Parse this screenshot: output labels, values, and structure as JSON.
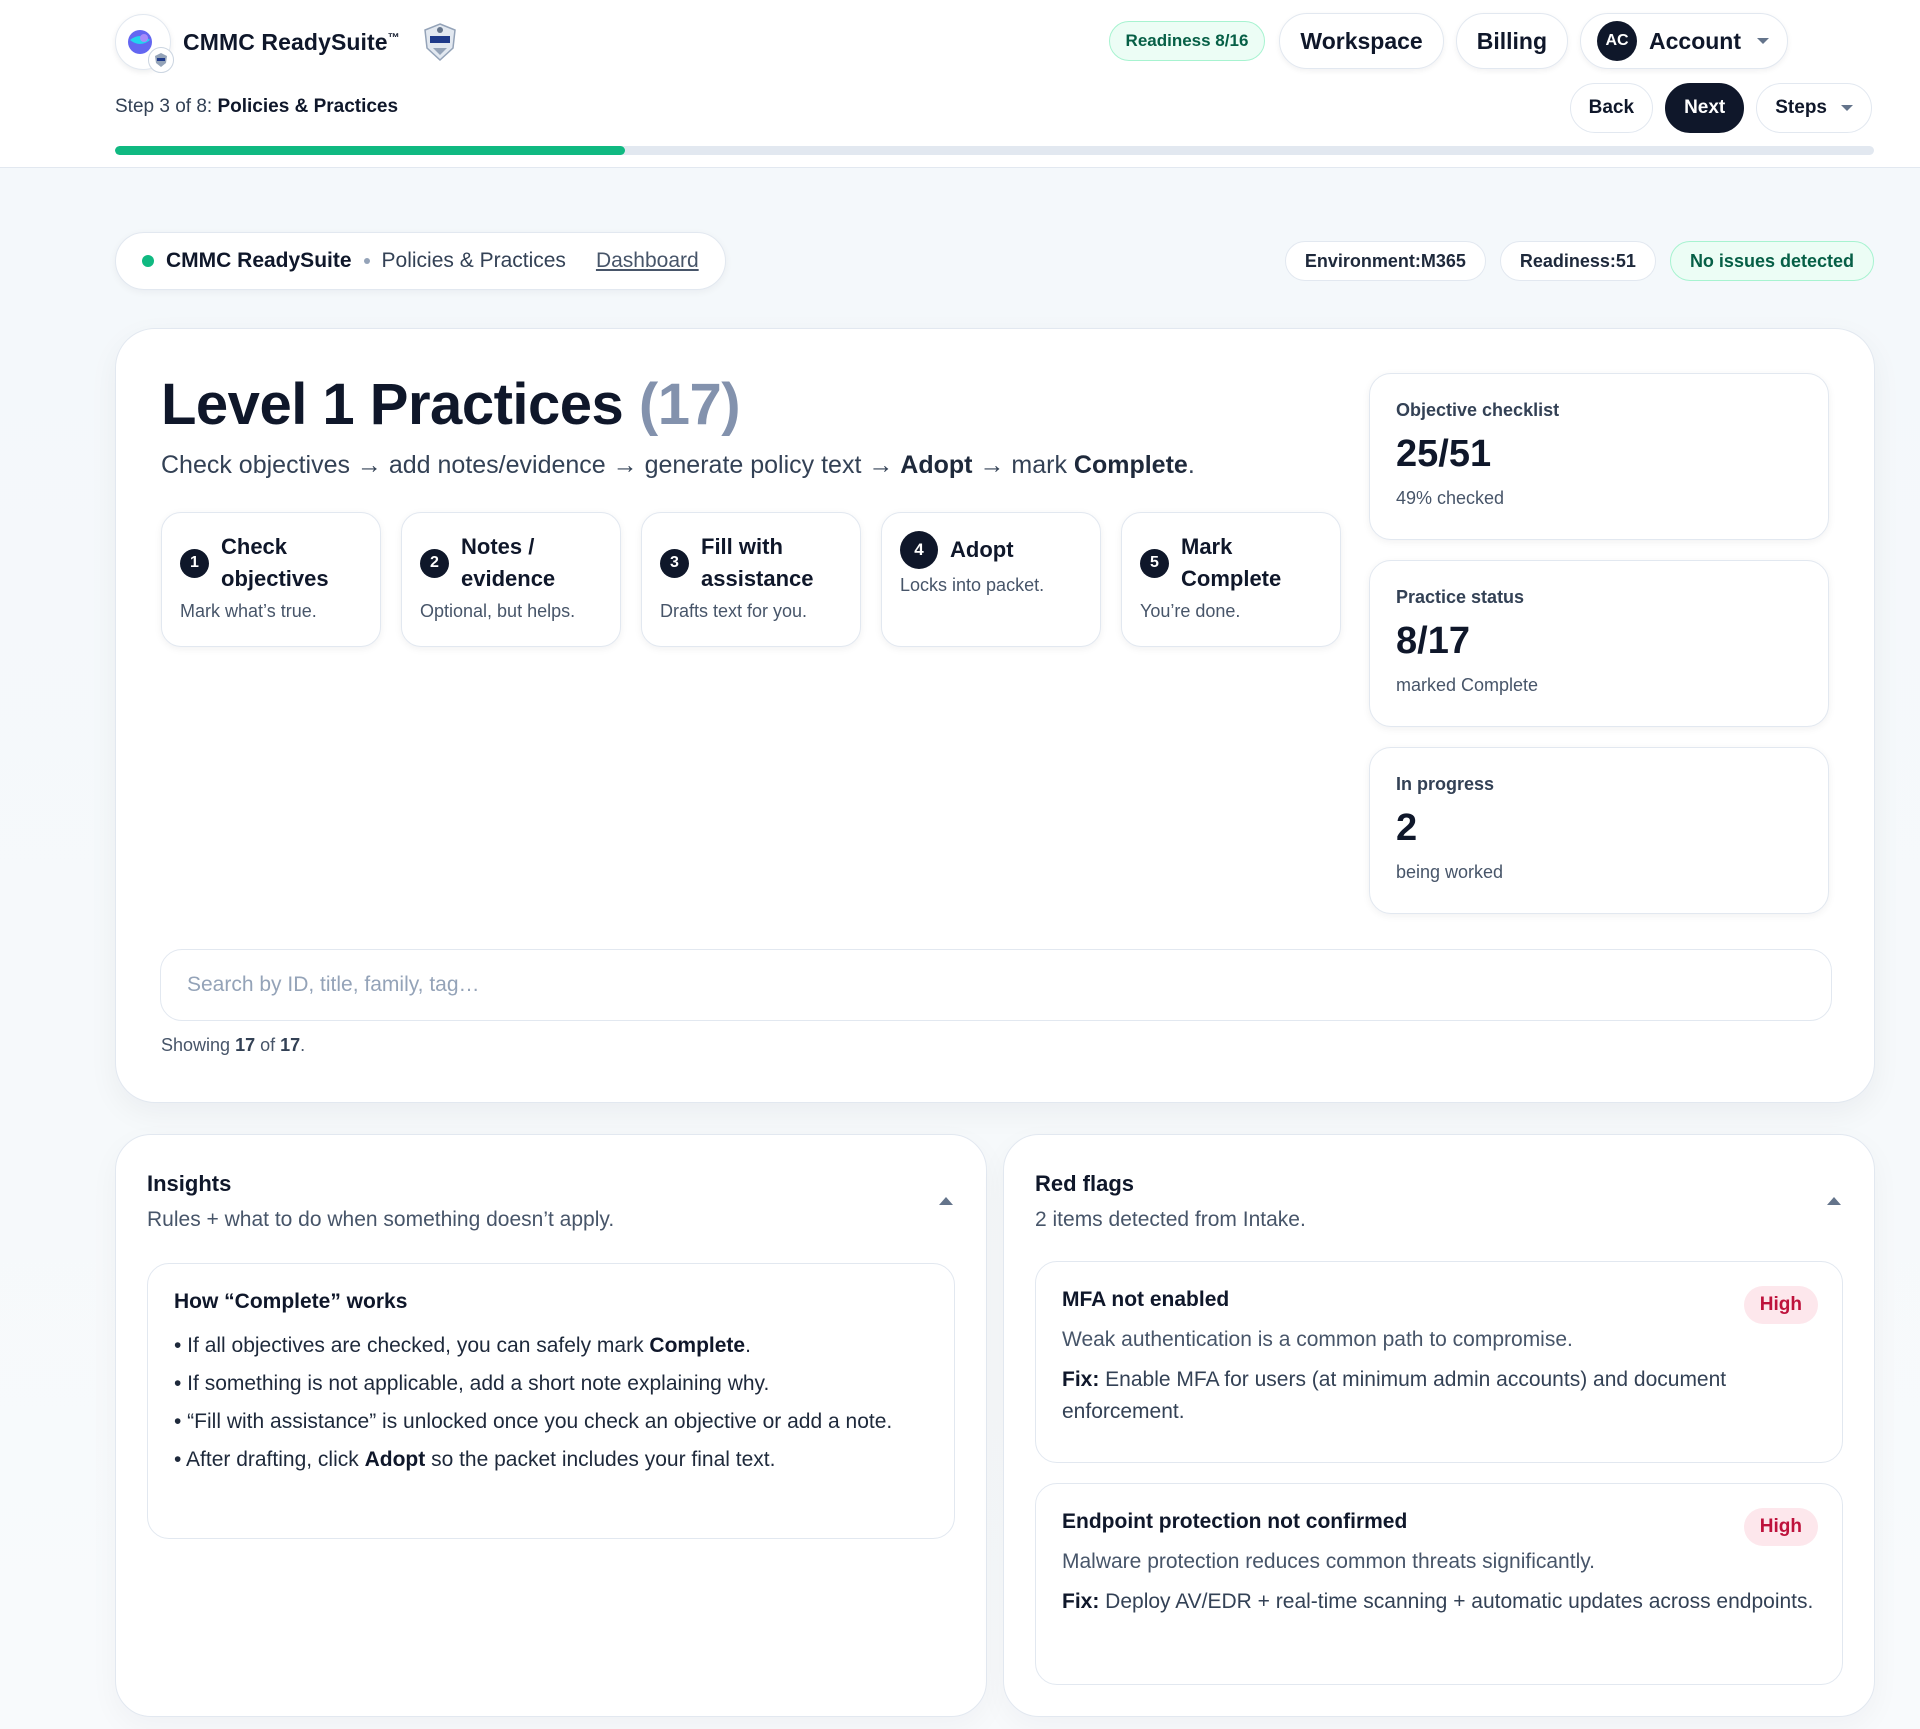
{
  "header": {
    "brand_name": "CMMC ReadySuite",
    "brand_mark": "™",
    "readiness_pill": "Readiness 8/16",
    "nav": {
      "workspace": "Workspace",
      "billing": "Billing",
      "account": "Account",
      "account_initials": "AC"
    },
    "step_prefix": "Step 3 of 8:",
    "step_name": "Policies & Practices",
    "back": "Back",
    "next": "Next",
    "steps": "Steps",
    "progress_fraction": 0.29
  },
  "breadcrumb": {
    "app": "CMMC ReadySuite",
    "page": "Policies & Practices",
    "link": "Dashboard"
  },
  "chips": {
    "environment": "Environment:M365",
    "readiness": "Readiness:51",
    "status": "No issues detected"
  },
  "main": {
    "title": "Level 1 Practices",
    "title_count": "(17)",
    "subtitle": {
      "part1": "Check objectives → add notes/evidence → generate policy text → ",
      "adopt": "Adopt",
      "part2": " → mark ",
      "complete": "Complete",
      "part3": "."
    },
    "steps": [
      {
        "num": "1",
        "title": "Check objectives",
        "desc": "Mark what’s true."
      },
      {
        "num": "2",
        "title": "Notes / evidence",
        "desc": "Optional, but helps."
      },
      {
        "num": "3",
        "title": "Fill with assistance",
        "desc": "Drafts text for you."
      },
      {
        "num": "4",
        "title": "Adopt",
        "desc": "Locks into packet."
      },
      {
        "num": "5",
        "title": "Mark Complete",
        "desc": "You’re done."
      }
    ],
    "stats": [
      {
        "label": "Objective checklist",
        "value": "25/51",
        "note": "49% checked"
      },
      {
        "label": "Practice status",
        "value": "8/17",
        "note": "marked Complete"
      },
      {
        "label": "In progress",
        "value": "2",
        "note": "being worked"
      }
    ],
    "search_placeholder": "Search by ID, title, family, tag…",
    "showing": {
      "prefix": "Showing",
      "shown": "17",
      "of": "of",
      "total": "17",
      "suffix": "."
    }
  },
  "insights": {
    "title": "Insights",
    "subtitle": "Rules + what to do when something doesn’t apply.",
    "card_title": "How “Complete” works",
    "bullets": [
      {
        "pre": "• If all objectives are checked, you can safely mark ",
        "bold": "Complete",
        "post": "."
      },
      {
        "pre": "• If something is not applicable, add a short note explaining why.",
        "bold": "",
        "post": ""
      },
      {
        "pre": "• “Fill with assistance” is unlocked once you check an objective or add a note.",
        "bold": "",
        "post": ""
      },
      {
        "pre": "• After drafting, click ",
        "bold": "Adopt",
        "post": " so the packet includes your final text."
      }
    ]
  },
  "red_flags": {
    "title": "Red flags",
    "subtitle": "2 items detected from Intake.",
    "items": [
      {
        "title": "MFA not enabled",
        "severity": "High",
        "desc": "Weak authentication is a common path to compromise.",
        "fix_label": "Fix:",
        "fix": " Enable MFA for users (at minimum admin accounts) and document enforcement."
      },
      {
        "title": "Endpoint protection not confirmed",
        "severity": "High",
        "desc": "Malware protection reduces common threats significantly.",
        "fix_label": "Fix:",
        "fix": " Deploy AV/EDR + real-time scanning + automatic updates across endpoints."
      }
    ]
  },
  "colors": {
    "accent": "#10b981",
    "dark": "#0f172a",
    "danger": "#be123c"
  },
  "icons": {
    "logo": "globe-logo-icon",
    "seal": "shield-seal-icon",
    "caret": "chevron-down-icon",
    "collapse": "chevron-up-icon"
  }
}
